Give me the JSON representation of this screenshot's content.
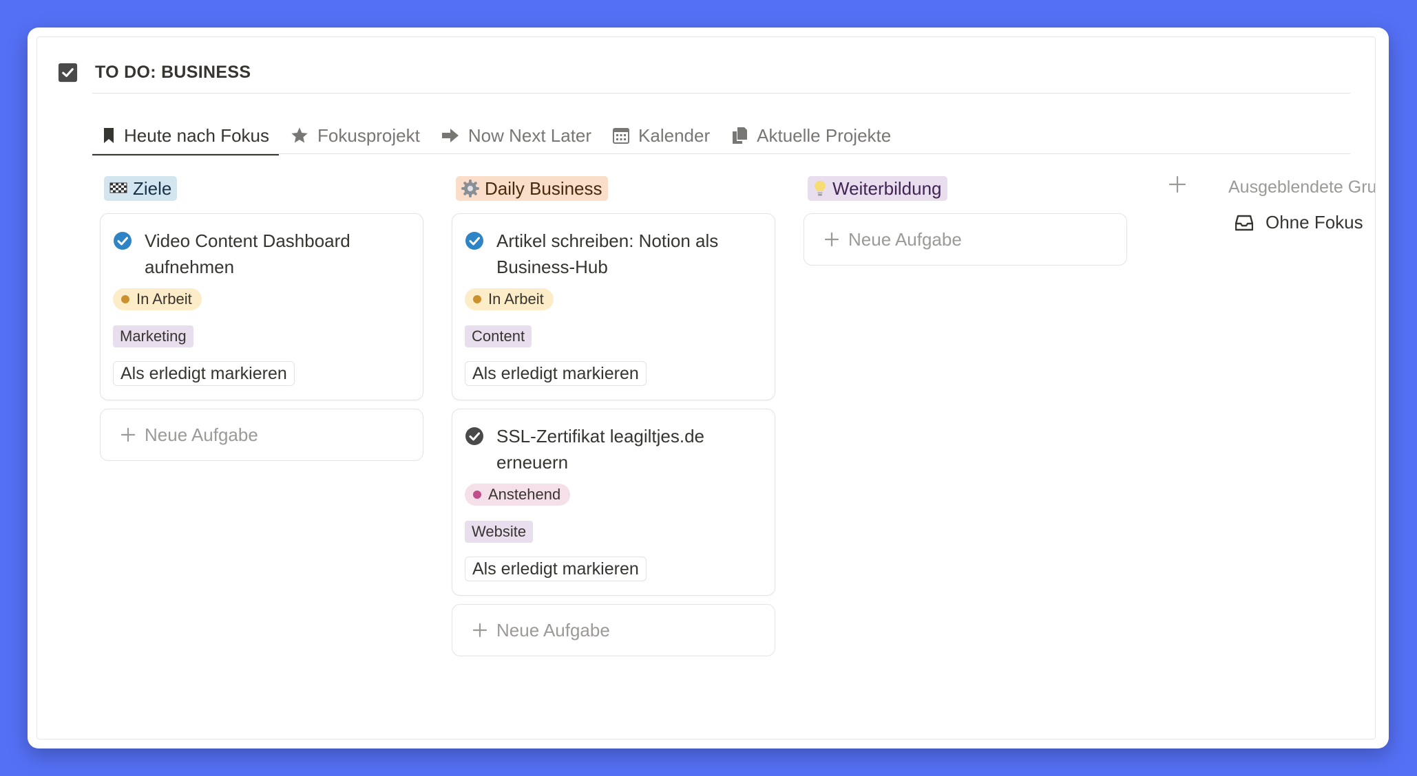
{
  "database": {
    "title": "TO DO: BUSINESS",
    "icon": "checkbox-icon"
  },
  "tabs": [
    {
      "label": "Heute nach Fokus",
      "icon": "bookmark-icon",
      "active": true
    },
    {
      "label": "Fokusprojekt",
      "icon": "star-icon",
      "active": false
    },
    {
      "label": "Now Next Later",
      "icon": "arrow-right-icon",
      "active": false
    },
    {
      "label": "Kalender",
      "icon": "calendar-icon",
      "active": false
    },
    {
      "label": "Aktuelle Projekte",
      "icon": "documents-icon",
      "active": false
    }
  ],
  "colors": {
    "background": "#5470f5",
    "ziele_label_bg": "#d3e5ef",
    "daily_label_bg": "#fadec9",
    "weiter_label_bg": "#e8deee",
    "in_arbeit_bg": "#fdecc8",
    "in_arbeit_dot": "#cb912f",
    "anstehend_bg": "#f5e0e9",
    "anstehend_dot": "#c14c8a",
    "check_blue": "#2f84c5"
  },
  "groups": [
    {
      "label": "Ziele",
      "emoji": "checkered-flag-icon",
      "cards": [
        {
          "title": "Video Content Dashboard aufnehmen",
          "status": "In Arbeit",
          "tag": "Marketing",
          "button": "Als erledigt markieren",
          "check": "blue-check-icon"
        }
      ],
      "new_label": "Neue Aufgabe"
    },
    {
      "label": "Daily Business",
      "emoji": "gear-icon",
      "cards": [
        {
          "title": "Artikel schreiben: Notion als Business-Hub",
          "status": "In Arbeit",
          "tag": "Content",
          "button": "Als erledigt markieren",
          "check": "blue-check-icon"
        },
        {
          "title": "SSL-Zertifikat leagiltjes.de erneuern",
          "status": "Anstehend",
          "tag": "Website",
          "button": "Als erledigt markieren",
          "check": "dark-check-icon"
        }
      ],
      "new_label": "Neue Aufgabe"
    },
    {
      "label": "Weiterbildung",
      "emoji": "lightbulb-icon",
      "cards": [],
      "new_label": "Neue Aufgabe"
    }
  ],
  "hidden_groups": {
    "label": "Ausgeblendete Gruppen",
    "item": "Ohne Fokus"
  }
}
